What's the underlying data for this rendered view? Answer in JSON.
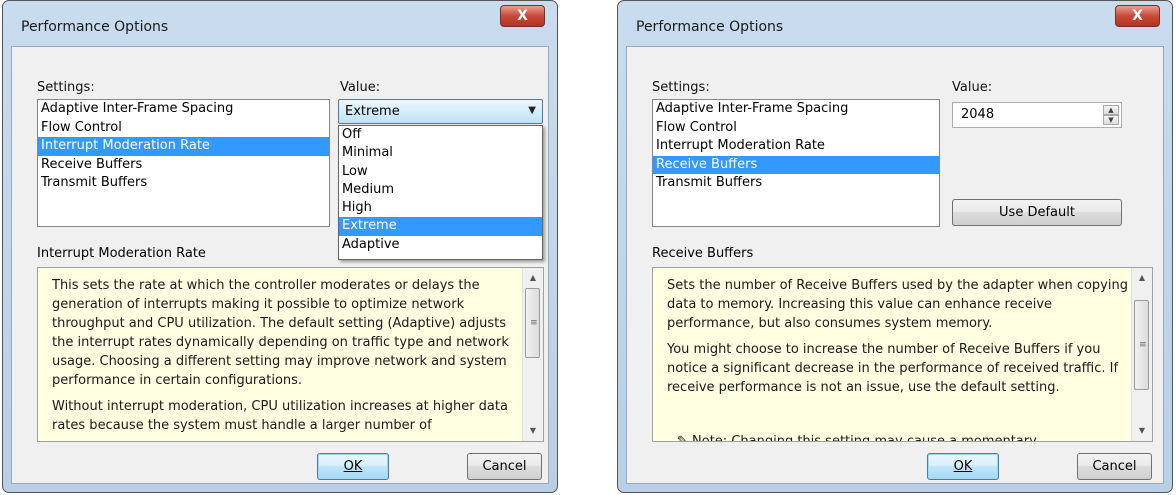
{
  "dialog_left": {
    "title": "Performance Options",
    "close_label": "X",
    "settings_label": "Settings:",
    "value_label": "Value:",
    "settings_items": [
      {
        "label": "Adaptive Inter-Frame Spacing",
        "selected": false
      },
      {
        "label": "Flow Control",
        "selected": false
      },
      {
        "label": "Interrupt Moderation Rate",
        "selected": true
      },
      {
        "label": "Receive Buffers",
        "selected": false
      },
      {
        "label": "Transmit Buffers",
        "selected": false
      }
    ],
    "combo_value": "Extreme",
    "dropdown_options": [
      "Off",
      "Minimal",
      "Low",
      "Medium",
      "High",
      "Extreme",
      "Adaptive"
    ],
    "dropdown_selected": "Extreme",
    "description_title": "Interrupt Moderation Rate",
    "description_paragraphs": [
      "This sets the rate at which the controller moderates or delays the generation of interrupts making it possible to optimize network throughput and CPU utilization. The default setting (Adaptive) adjusts the interrupt rates dynamically depending on traffic type and network usage. Choosing a different setting may improve network and system performance in certain configurations.",
      "Without interrupt moderation, CPU utilization increases at higher data rates because the system must handle a larger number of"
    ],
    "ok_label": "OK",
    "cancel_label": "Cancel"
  },
  "dialog_right": {
    "title": "Performance Options",
    "close_label": "X",
    "settings_label": "Settings:",
    "value_label": "Value:",
    "settings_items": [
      {
        "label": "Adaptive Inter-Frame Spacing",
        "selected": false
      },
      {
        "label": "Flow Control",
        "selected": false
      },
      {
        "label": "Interrupt Moderation Rate",
        "selected": false
      },
      {
        "label": "Receive Buffers",
        "selected": true
      },
      {
        "label": "Transmit Buffers",
        "selected": false
      }
    ],
    "spin_value": "2048",
    "use_default_label": "Use Default",
    "description_title": "Receive Buffers",
    "description_paragraphs": [
      "Sets the number of Receive Buffers used by the adapter when copying data to memory. Increasing this value can enhance receive performance, but also consumes system memory.",
      "You might choose to increase the number of Receive Buffers if you notice a significant decrease in the performance of received traffic. If receive performance is not an issue, use the default setting."
    ],
    "note_cut_text": "Note: Changing this setting may cause a momentary",
    "ok_label": "OK",
    "cancel_label": "Cancel"
  },
  "colors": {
    "selection": "#3399ff",
    "description_bg": "#ffffe1",
    "window_frame": "#b9cfe6",
    "close_button": "#c9493a"
  }
}
